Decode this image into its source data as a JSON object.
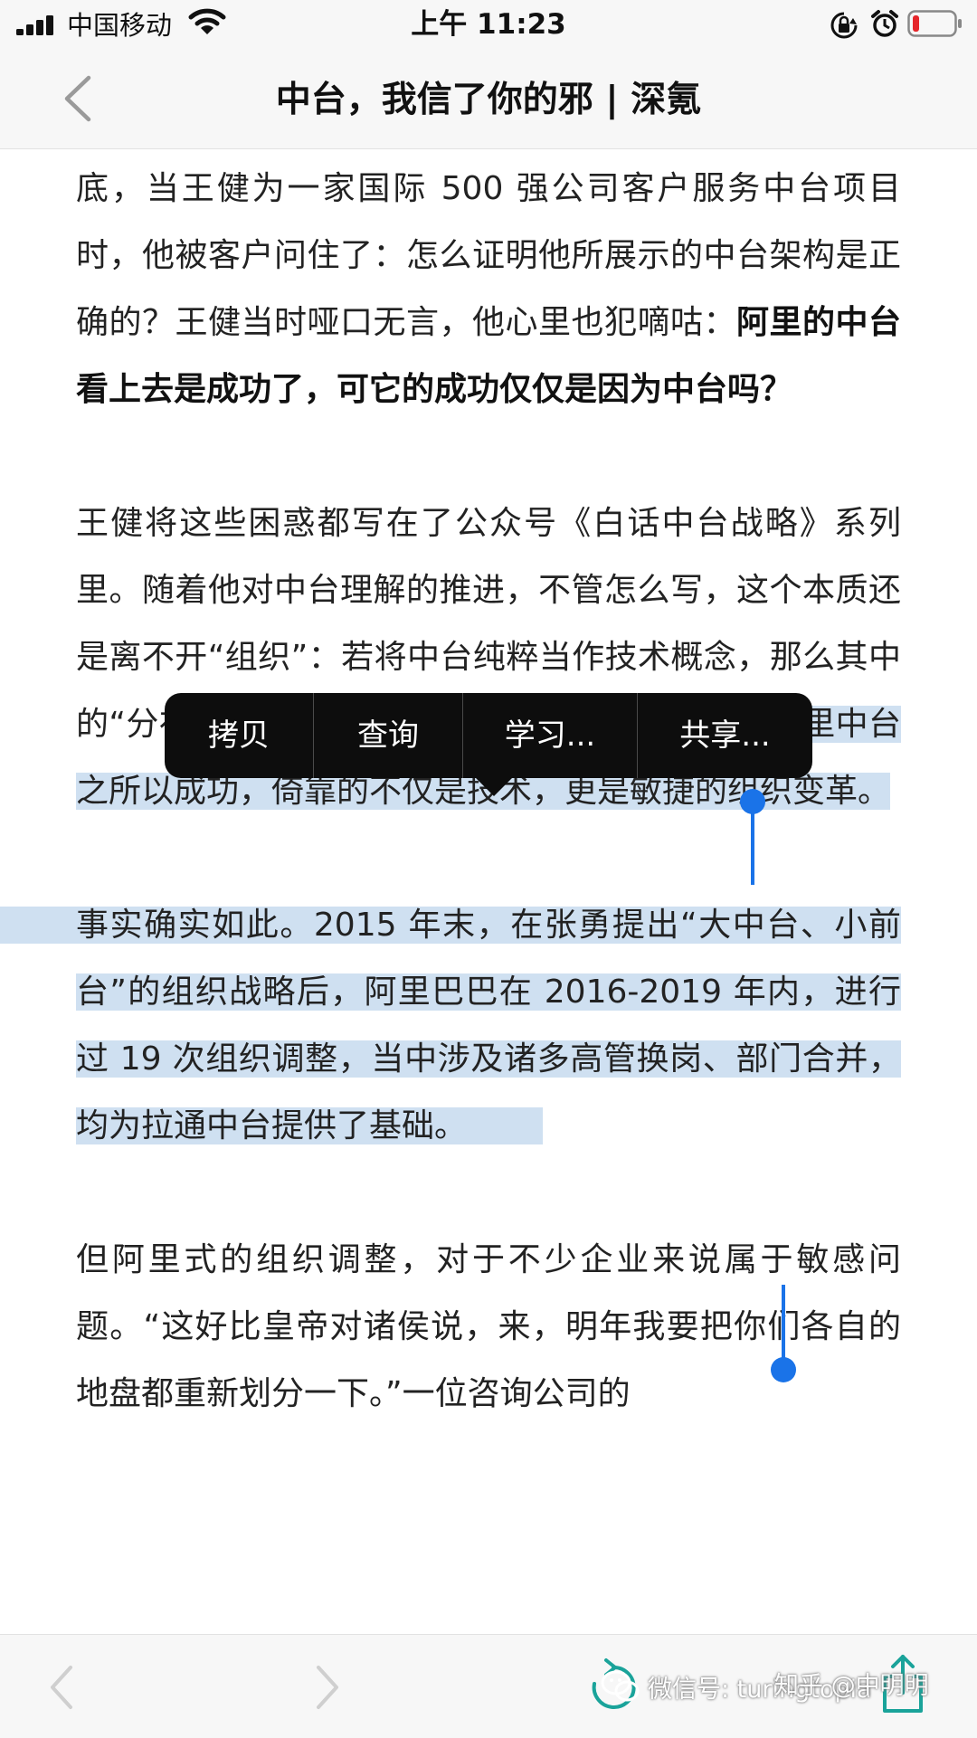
{
  "status_bar": {
    "carrier": "中国移动",
    "time": "上午 11:23",
    "icons": [
      "signal-icon",
      "wifi-icon",
      "lock-rotation-icon",
      "alarm-icon",
      "battery-low-icon"
    ],
    "battery_color": "#e5252a"
  },
  "nav": {
    "title": "中台，我信了你的邪 | 深氪",
    "back_icon": "chevron-left-icon"
  },
  "article": {
    "p1_text": "底，当王健为一家国际 500 强公司客户服务中台项目时，他被客户问住了：怎么证明他所展示的中台架构是正确的？王健当时哑口无言，他心里也犯嘀咕：",
    "p1_bold": "阿里的中台看上去是成功了，可它的成功仅仅是因为中台吗？",
    "p2_text": "王健将这些困惑都写在了公众号《白话中台战略》系列里。随着他对中台理解的推进，不管怎么写，这个本质还是离不开“组织”：若将中台纯粹当作技术概念，那么其中的“分布式、微服务，早已是老套的 IT 名词；",
    "p2_selected": "但阿里中台之所以成功，倚靠的不仅是技术，更是敏捷的组织变革。",
    "p3_selected": "事实确实如此。2015 年末，在张勇提出“大中台、小前台”的组织战略后，阿里巴巴在 2016-2019 年内，进行过 19 次组织调整，当中涉及诸多高管换岗、部门合并，均为拉通中台提供了基础。",
    "p4_text": "但阿里式的组织调整，对于不少企业来说属于敏感问题。“这好比皇帝对诸侯说，来，明年我要把你们各自的地盘都重新划分一下。”一位咨询公司的"
  },
  "callout_menu": {
    "items": [
      "拷贝",
      "查询",
      "学习...",
      "共享..."
    ]
  },
  "toolbar": {
    "icons": [
      "back-arrow-icon",
      "forward-arrow-icon",
      "reload-icon",
      "share-icon"
    ],
    "watermark_wechat": "微信号: turingtopia",
    "watermark_zhihu": "知乎 @中明明"
  },
  "colors": {
    "selection": "#cfe0f1",
    "handle": "#1a73e8",
    "menu_bg": "#0d0d0d",
    "bar_bg": "#f7f7f7"
  }
}
